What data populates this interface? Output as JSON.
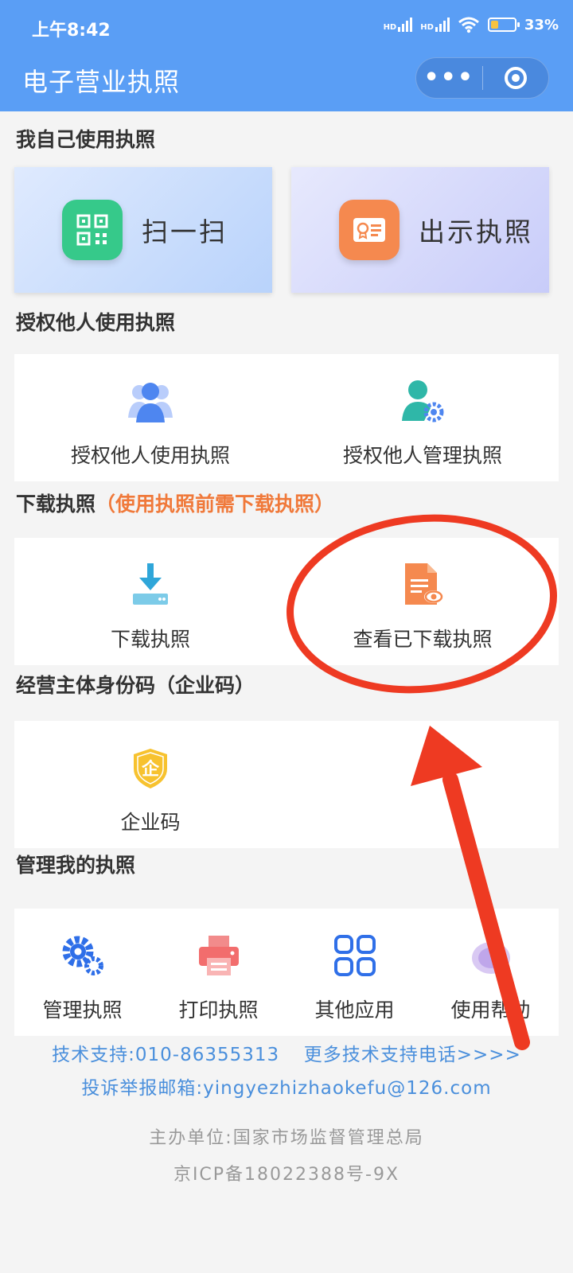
{
  "status": {
    "time": "上午8:42",
    "hd1": "HD",
    "hd2": "HD",
    "battery": "33%",
    "battery_level": 0.33
  },
  "header": {
    "title": "电子营业执照",
    "more_glyph": "•••"
  },
  "self_use": {
    "title": "我自己使用执照",
    "scan_label": "扫一扫",
    "show_label": "出示执照"
  },
  "authorize": {
    "title": "授权他人使用执照",
    "items": [
      {
        "label": "授权他人使用执照",
        "icon": "users-icon"
      },
      {
        "label": "授权他人管理执照",
        "icon": "user-gear-icon"
      }
    ]
  },
  "download": {
    "title": "下载执照",
    "hint": "（使用执照前需下载执照）",
    "items": [
      {
        "label": "下载执照",
        "icon": "download-icon"
      },
      {
        "label": "查看已下载执照",
        "icon": "view-document-icon"
      }
    ]
  },
  "entity_code": {
    "title": "经营主体身份码（企业码）",
    "items": [
      {
        "label": "企业码",
        "icon": "enterprise-shield-icon",
        "glyph": "企"
      }
    ]
  },
  "manage": {
    "title": "管理我的执照",
    "items": [
      {
        "label": "管理执照",
        "icon": "gears-icon"
      },
      {
        "label": "打印执照",
        "icon": "printer-icon"
      },
      {
        "label": "其他应用",
        "icon": "apps-grid-icon"
      },
      {
        "label": "使用帮助",
        "icon": "help-icon"
      }
    ]
  },
  "footer": {
    "support": "技术支持:010-86355313",
    "more_support": "更多技术支持电话>>>>",
    "complaint": "投诉举报邮箱:yingyezhizhaokefu@126.com",
    "sponsor": "主办单位:国家市场监督管理总局",
    "icp": "京ICP备18022388号-9X"
  },
  "colors": {
    "header": "#5a9ef5",
    "accent_orange": "#f0793a",
    "link_blue": "#4a8fdc",
    "annotation_red": "#ee3a22"
  }
}
